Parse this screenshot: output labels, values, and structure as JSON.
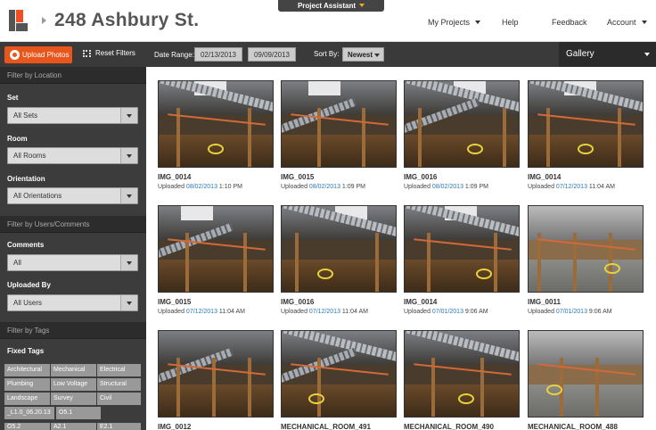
{
  "header": {
    "title": "248 Ashbury St.",
    "project_assistant": "Project Assistant",
    "nav": [
      "My Projects",
      "Help",
      "Feedback",
      "Account"
    ]
  },
  "toolbar": {
    "upload_label": "Upload Photos",
    "reset_label": "Reset Filters",
    "date_range_label": "Date Range:",
    "date_from": "02/13/2013",
    "date_to": "09/09/2013",
    "sort_label": "Sort By:",
    "sort_value": "Newest",
    "view_label": "Gallery"
  },
  "sidebar": {
    "location_header": "Filter by Location",
    "set_label": "Set",
    "set_value": "All Sets",
    "room_label": "Room",
    "room_value": "All Rooms",
    "orientation_label": "Orientation",
    "orientation_value": "All Orientations",
    "users_header": "Filter by Users/Comments",
    "comments_label": "Comments",
    "comments_value": "All",
    "uploaded_by_label": "Uploaded By",
    "uploaded_by_value": "All Users",
    "tags_header": "Filter by Tags",
    "fixed_tags_label": "Fixed Tags",
    "tags": [
      "Architectural",
      "Mechanical",
      "Electrical",
      "Plumbing",
      "Low Voltage",
      "Structural",
      "Landscape",
      "Survey",
      "Civil",
      "_L1.0_06.20.13",
      "O5.1",
      "O5.2",
      "A2.1",
      "E2.1"
    ]
  },
  "gallery": {
    "uploaded_prefix": "Uploaded",
    "photos": [
      {
        "name": "IMG_0014",
        "date": "08/02/2013",
        "time": "1:10 PM"
      },
      {
        "name": "IMG_0015",
        "date": "08/02/2013",
        "time": "1:09 PM"
      },
      {
        "name": "IMG_0016",
        "date": "08/02/2013",
        "time": "1:09 PM"
      },
      {
        "name": "IMG_0014",
        "date": "07/12/2013",
        "time": "11:04 AM"
      },
      {
        "name": "IMG_0015",
        "date": "07/12/2013",
        "time": "11:04 AM"
      },
      {
        "name": "IMG_0016",
        "date": "07/12/2013",
        "time": "11:04 AM"
      },
      {
        "name": "IMG_0014",
        "date": "07/01/2013",
        "time": "9:06 AM"
      },
      {
        "name": "IMG_0011",
        "date": "07/01/2013",
        "time": "9:06 AM"
      },
      {
        "name": "IMG_0012",
        "date": "",
        "time": ""
      },
      {
        "name": "MECHANICAL_ROOM_491",
        "date": "",
        "time": ""
      },
      {
        "name": "MECHANICAL_ROOM_490",
        "date": "",
        "time": ""
      },
      {
        "name": "MECHANICAL_ROOM_488",
        "date": "",
        "time": ""
      }
    ]
  }
}
